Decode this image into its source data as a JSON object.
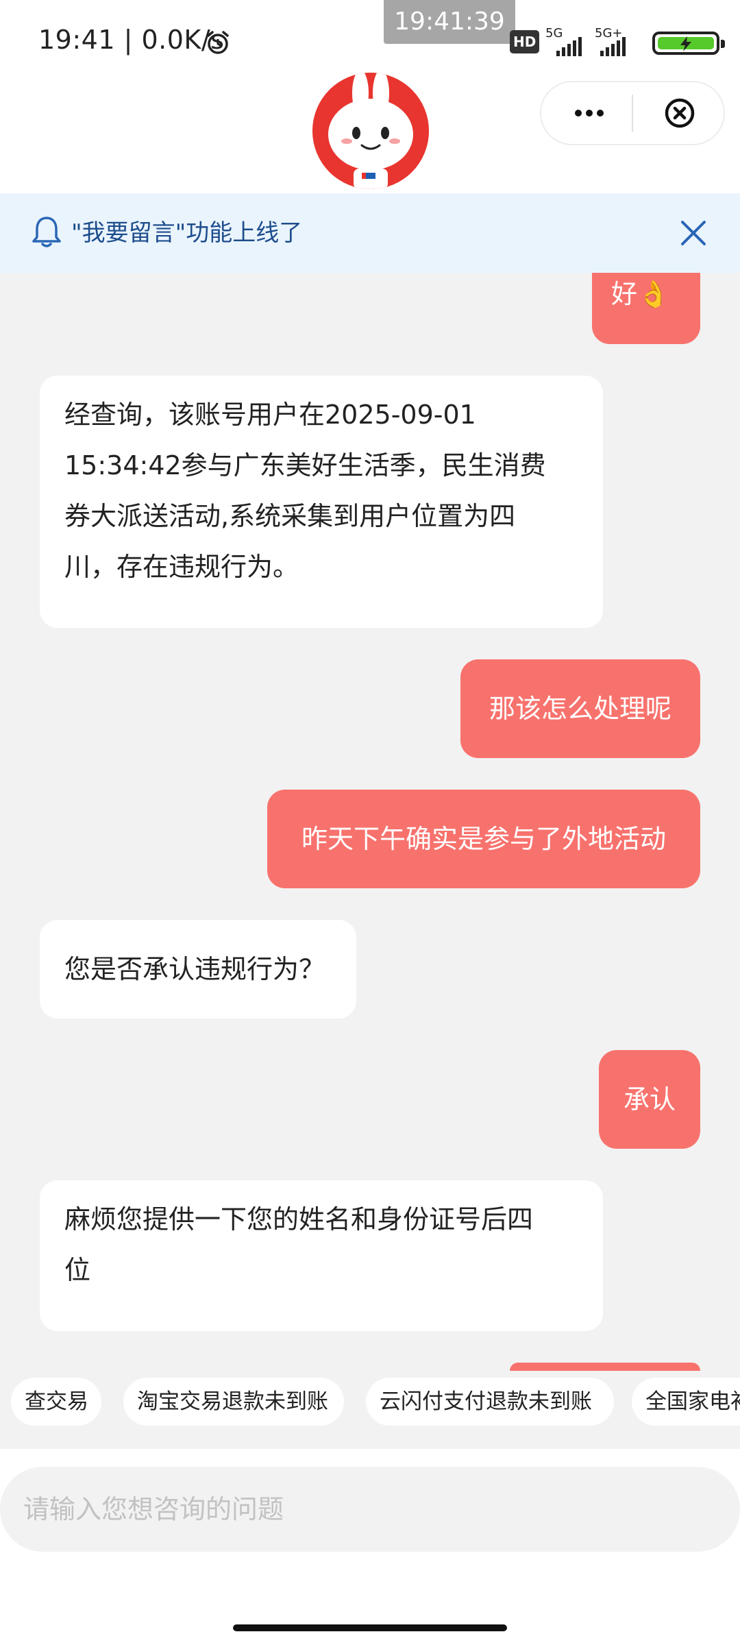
{
  "status_bar": {
    "time_speed": "19:41 | 0.0K/s",
    "system_clock": "19:41:39",
    "hd_badge": "HD",
    "network_1": "5G",
    "network_2": "5G+"
  },
  "header": {
    "mascot_icon": "rabbit-mascot-icon",
    "menu_icon": "more-dots-icon",
    "close_icon": "close-circle-icon"
  },
  "notice": {
    "text": "\"我要留言\"功能上线了",
    "icon": "bell-icon",
    "close_icon": "close-icon"
  },
  "messages": [
    {
      "role": "user",
      "text": "好👌"
    },
    {
      "role": "bot",
      "lines": [
        "经查询，该账号用户在2025-09-01",
        "15:34:42参与广东美好生活季，民生消费",
        "券大派送活动,系统采集到用户位置为四",
        "川，存在违规行为。"
      ]
    },
    {
      "role": "user",
      "text": "那该怎么处理呢"
    },
    {
      "role": "user",
      "text": "昨天下午确实是参与了外地活动"
    },
    {
      "role": "bot",
      "lines": [
        "您是否承认违规行为？"
      ]
    },
    {
      "role": "user",
      "text": "承认"
    },
    {
      "role": "bot",
      "lines": [
        "麻烦您提供一下您的姓名和身份证号后四",
        "位"
      ]
    }
  ],
  "quick_tags": [
    "查交易",
    "淘宝交易退款未到账",
    "云闪付支付退款未到账",
    "全国家电补"
  ],
  "input": {
    "placeholder": "请输入您想咨询的问题"
  },
  "colors": {
    "user_bubble": "#f8726d",
    "bot_bubble": "#ffffff",
    "chat_bg": "#f2f2f2",
    "notice_bg": "#eaf4fd",
    "notice_text": "#1d4d8c",
    "mascot_red": "#e8352f"
  }
}
